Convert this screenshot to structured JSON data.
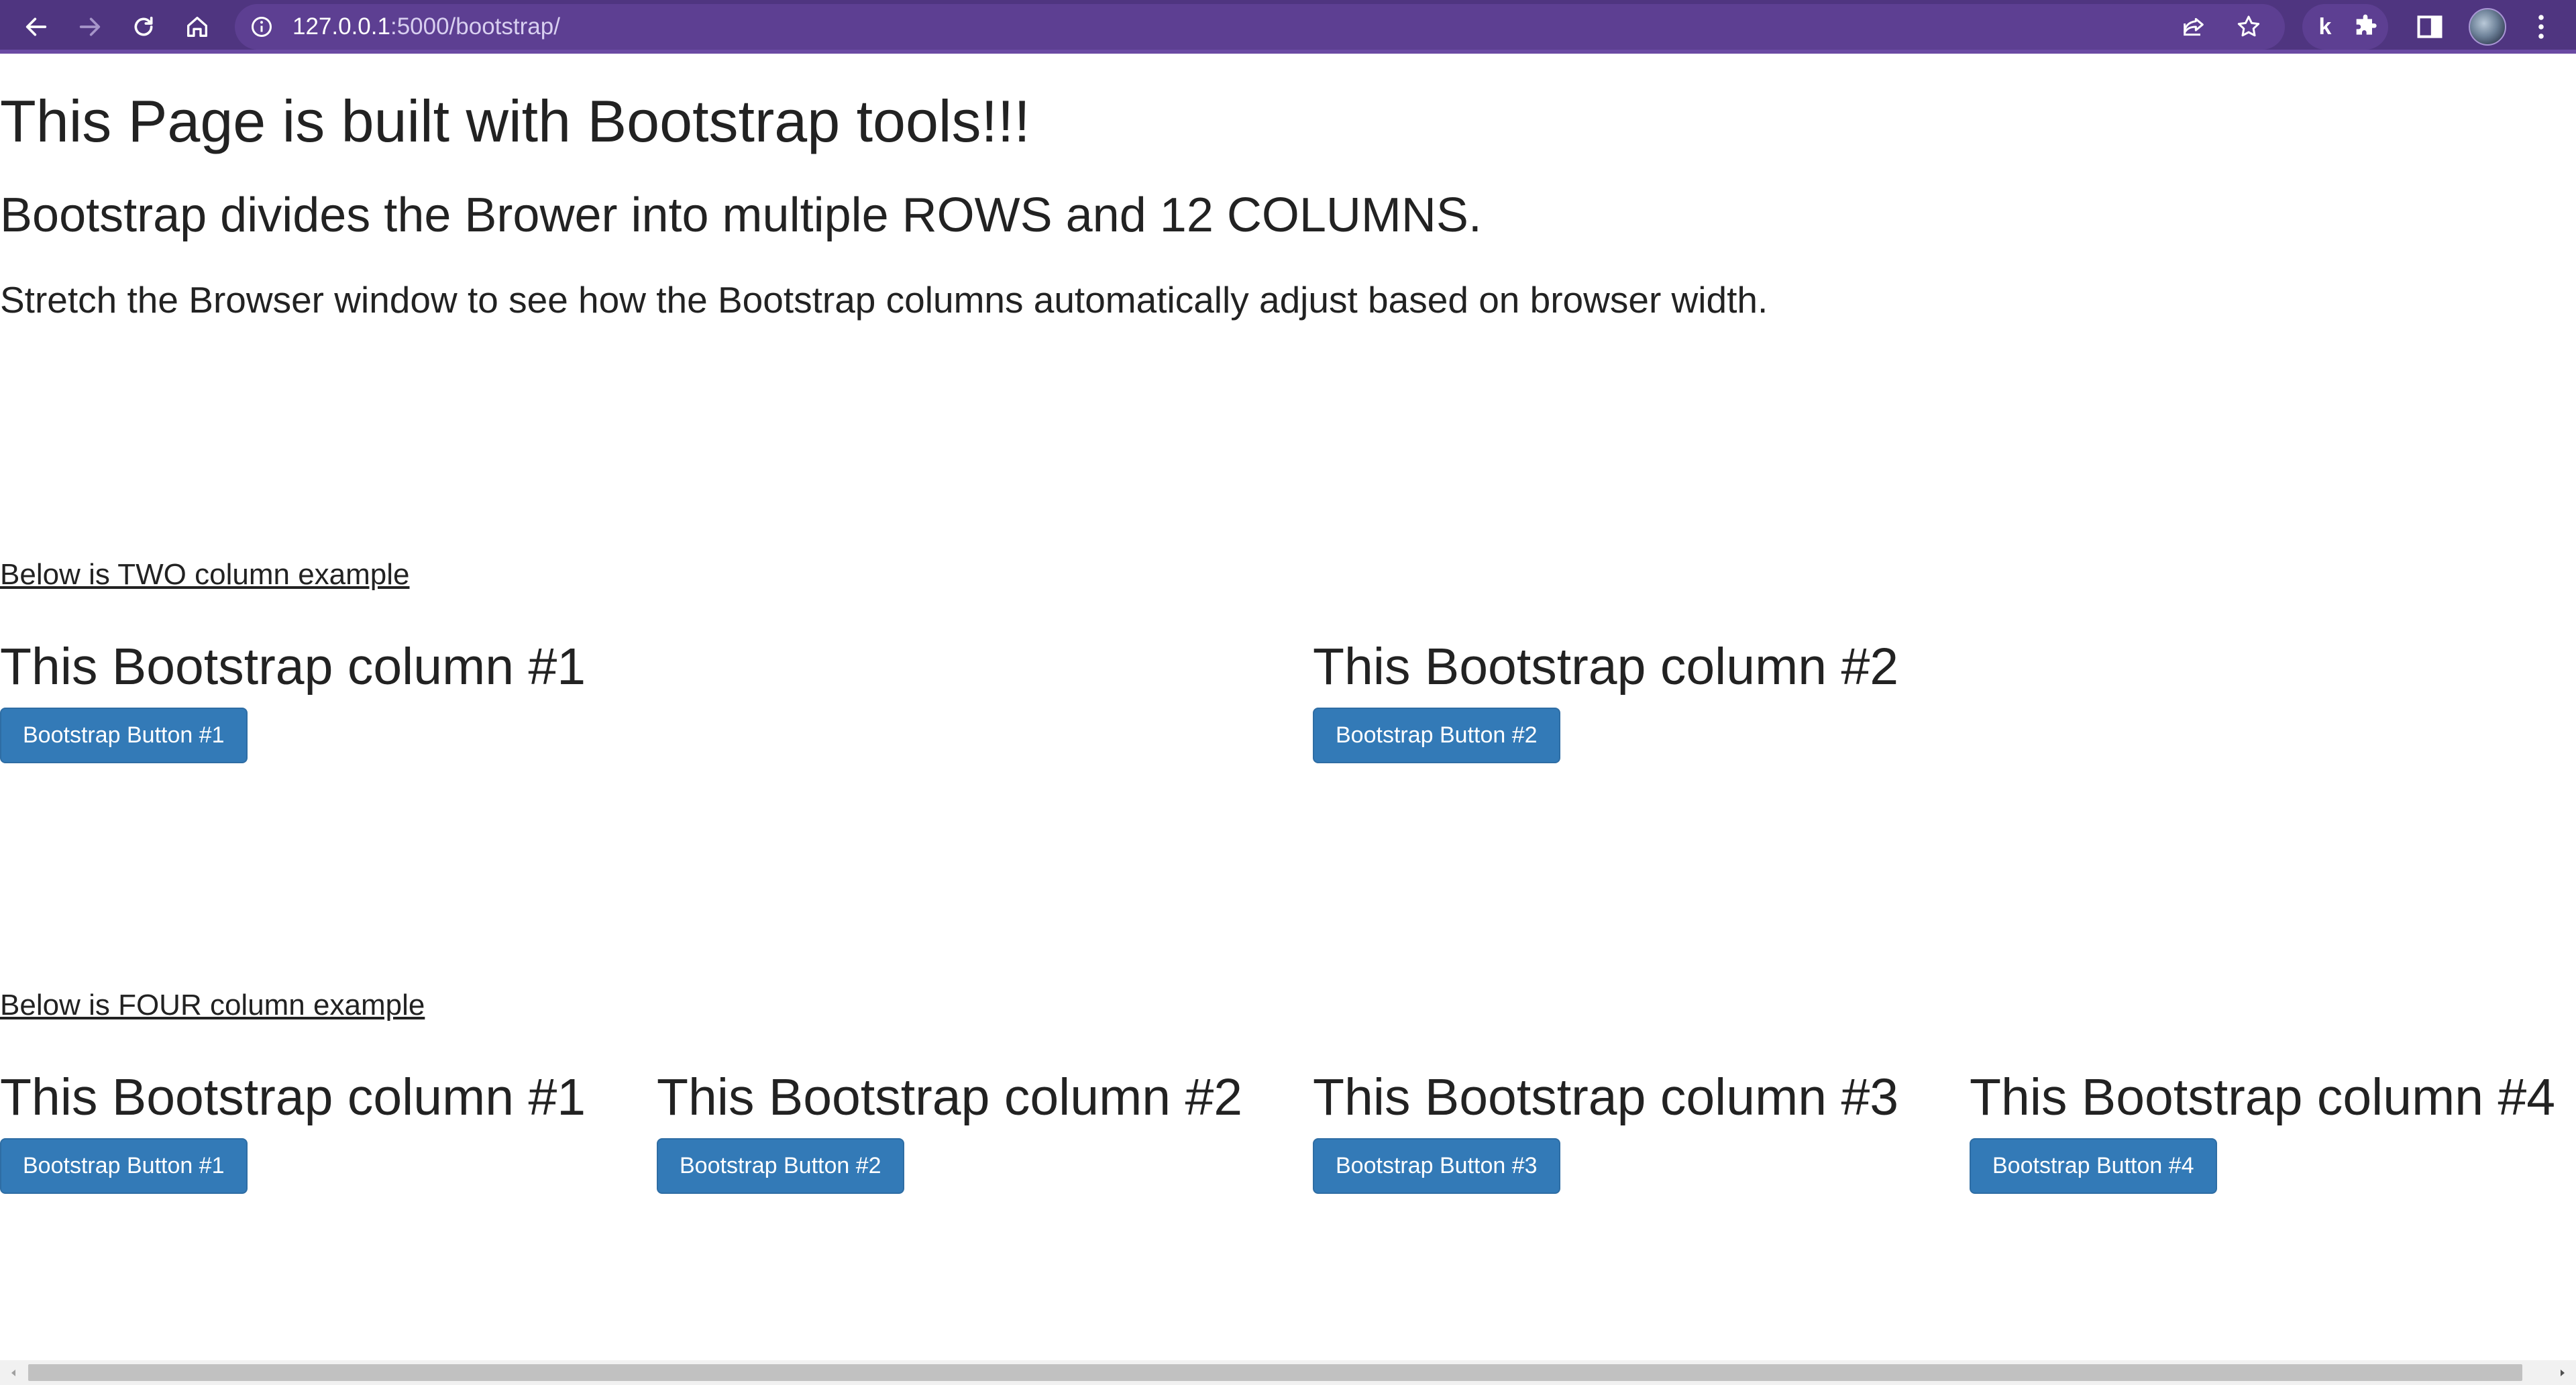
{
  "browser": {
    "url_host": "127.0.0.1",
    "url_rest": ":5000/bootstrap/",
    "extension_label": "k",
    "theme_color": "#4f3580"
  },
  "page": {
    "title": "This Page is built with Bootstrap tools!!!",
    "subtitle": "Bootstrap divides the Brower into multiple ROWS and 12 COLUMNS.",
    "lead": "Stretch the Browser window to see how the Bootstrap columns automatically adjust based on browser width.",
    "two_col": {
      "link": "Below is TWO column example",
      "columns": [
        {
          "heading": "This Bootstrap column #1",
          "button": "Bootstrap Button #1"
        },
        {
          "heading": "This Bootstrap column #2",
          "button": "Bootstrap Button #2"
        }
      ]
    },
    "four_col": {
      "link": "Below is FOUR column example",
      "columns": [
        {
          "heading": "This Bootstrap column #1",
          "button": "Bootstrap Button #1"
        },
        {
          "heading": "This Bootstrap column #2",
          "button": "Bootstrap Button #2"
        },
        {
          "heading": "This Bootstrap column #3",
          "button": "Bootstrap Button #3"
        },
        {
          "heading": "This Bootstrap column #4",
          "button": "Bootstrap Button #4"
        }
      ]
    },
    "button_color": "#337ab7"
  },
  "icons": {
    "back": "back-arrow-icon",
    "forward": "forward-arrow-icon",
    "reload": "reload-icon",
    "home": "home-icon",
    "info": "info-icon",
    "share": "share-icon",
    "bookmark": "star-icon",
    "extensions": "puzzle-icon",
    "side_panel": "side-panel-icon",
    "menu": "kebab-menu-icon"
  }
}
